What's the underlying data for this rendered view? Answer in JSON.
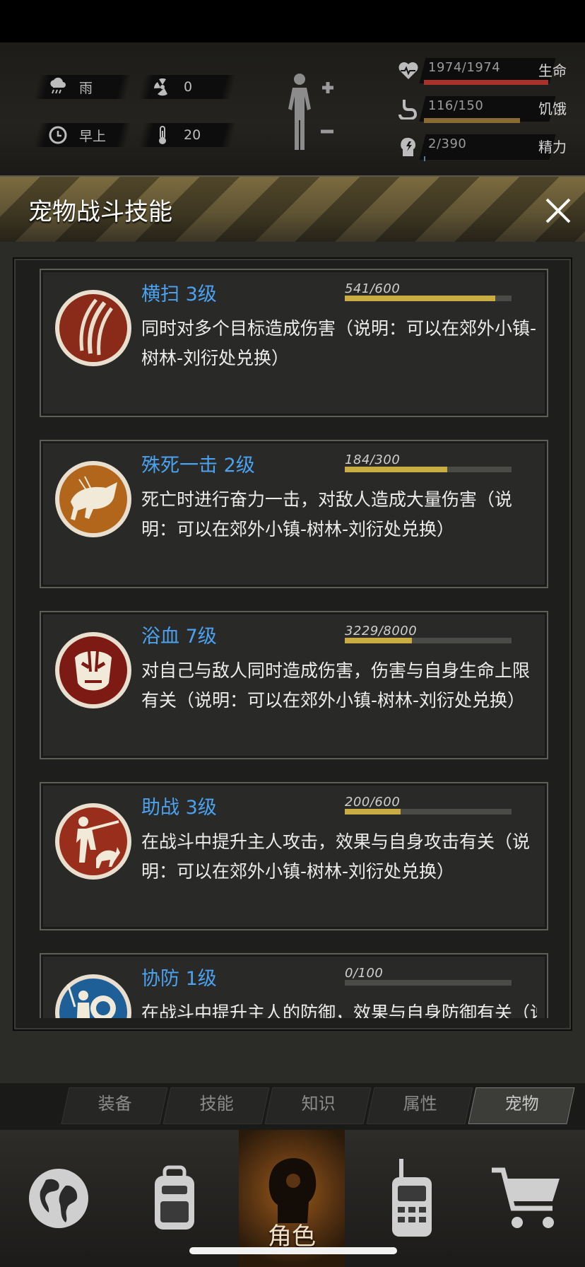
{
  "hud": {
    "weather": "雨",
    "radiation": "0",
    "time_of_day": "早上",
    "temperature": "20",
    "stats": [
      {
        "key": "health",
        "value": "1974/1974",
        "label": "生命",
        "fill": 1.0,
        "color": "#a8322a"
      },
      {
        "key": "hunger",
        "value": "116/150",
        "label": "饥饿",
        "fill": 0.77,
        "color": "#8a6a34"
      },
      {
        "key": "energy",
        "value": "2/390",
        "label": "精力",
        "fill": 0.005,
        "color": "#5a7a9a"
      }
    ]
  },
  "dialog": {
    "title": "宠物战斗技能"
  },
  "skills": [
    {
      "name": "横扫 3级",
      "progress": "541/600",
      "fill": 0.9017,
      "desc": "同时对多个目标造成伤害（说明：可以在郊外小镇-树林-刘衍处兑换）",
      "icon": "claw-marks-icon"
    },
    {
      "name": "殊死一击 2级",
      "progress": "184/300",
      "fill": 0.6133,
      "desc": "死亡时进行奋力一击，对敌人造成大量伤害（说明：可以在郊外小镇-树林-刘衍处兑换）",
      "icon": "charging-beast-icon"
    },
    {
      "name": "浴血 7级",
      "progress": "3229/8000",
      "fill": 0.4036,
      "desc": "对自己与敌人同时造成伤害，伤害与自身生命上限有关（说明：可以在郊外小镇-树林-刘衍处兑换）",
      "icon": "blood-face-icon"
    },
    {
      "name": "助战 3级",
      "progress": "200/600",
      "fill": 0.3333,
      "desc": "在战斗中提升主人攻击，效果与自身攻击有关（说明：可以在郊外小镇-树林-刘衍处兑换）",
      "icon": "hunter-dog-icon"
    },
    {
      "name": "协防 1级",
      "progress": "0/100",
      "fill": 0.0,
      "desc": "在战斗中提升主人的防御，效果与自身防御有关（说",
      "icon": "shield-warrior-icon"
    }
  ],
  "sub_tabs": [
    "装备",
    "技能",
    "知识",
    "属性",
    "宠物"
  ],
  "sub_tab_active": 4,
  "nav": {
    "items": [
      "map-globe-icon",
      "backpack-icon",
      "character-head-icon",
      "radio-icon",
      "cart-icon"
    ],
    "active_label": "角色"
  },
  "colors": {
    "accent_blue": "#4aa2f0",
    "progress_gold": "#c9ad42"
  }
}
